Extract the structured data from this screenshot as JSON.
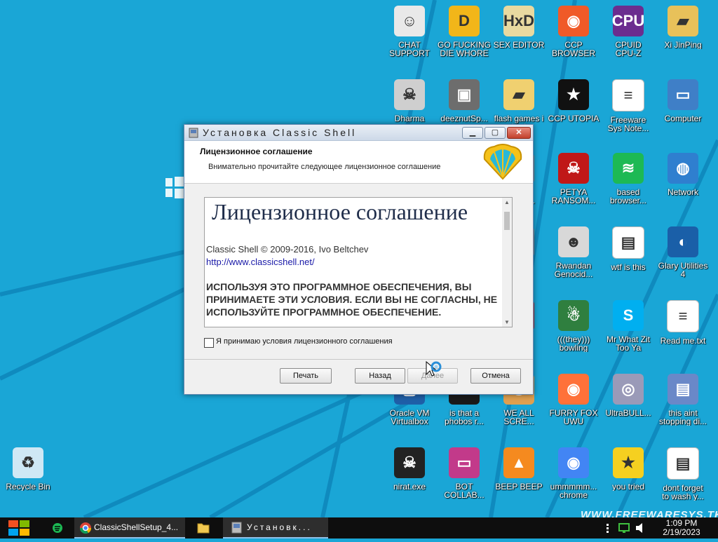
{
  "installer": {
    "title": "Установка Classic Shell",
    "min_label": "▁",
    "max_label": "▢",
    "close_label": "✕",
    "header_title": "Лицензионное соглашение",
    "header_subtitle": "Внимательно прочитайте следующее лицензионное соглашение",
    "license": {
      "heading": "Лицензионное соглашение",
      "copyright": "Classic Shell © 2009-2016, Ivo Beltchev",
      "link": "http://www.classicshell.net/",
      "notice": "ИСПОЛЬЗУЯ ЭТО ПРОГРАММНОЕ ОБЕСПЕЧЕНИЯ, ВЫ ПРИНИМАЕТЕ ЭТИ УСЛОВИЯ. ЕСЛИ ВЫ НЕ СОГЛАСНЫ, НЕ ИСПОЛЬЗУЙТЕ ПРОГРАММНОЕ ОБЕСПЕЧЕНИЕ."
    },
    "accept_label": "Я принимаю условия лицензионного соглашения",
    "accept_checked": false,
    "buttons": {
      "print": "Печать",
      "back": "Назад",
      "next": "Далее",
      "cancel": "Отмена"
    }
  },
  "desktop_icons": [
    {
      "label": "CHAT\nSUPPORT",
      "icon": "doctor-icon",
      "color": "#e9e9e9"
    },
    {
      "label": "GO FUCKING\nDIE WHORE",
      "icon": "die-icon",
      "color": "#f2b619"
    },
    {
      "label": "SEX EDITOR",
      "icon": "hxd-icon",
      "color": "#e8d9a0"
    },
    {
      "label": "CCP\nBROWSER",
      "icon": "browser-icon",
      "color": "#f05a28"
    },
    {
      "label": "CPUID\nCPU-Z",
      "icon": "cpuz-icon",
      "color": "#6b2d8f"
    },
    {
      "label": "Xi JinPing",
      "icon": "folder-user-icon",
      "color": "#e8c15a"
    },
    {
      "label": "Dharma",
      "icon": "skull-icon",
      "color": "#cfcfcf"
    },
    {
      "label": "deeznutSp...",
      "icon": "windows-stack-icon",
      "color": "#6d6d6d"
    },
    {
      "label": "flash games i\nhad",
      "icon": "folder-icon",
      "color": "#f0d070"
    },
    {
      "label": "CCP UTOPIA",
      "icon": "ccp-icon",
      "color": "#111111"
    },
    {
      "label": "Freeware\nSys Note...",
      "icon": "document-icon",
      "color": "#ffffff"
    },
    {
      "label": "Computer",
      "icon": "computer-icon",
      "color": "#3f7fc7"
    },
    {
      "label": "...NG\nNSOM...",
      "icon": "partial-icon",
      "color": "#888888"
    },
    {
      "label": "PETYA\nRANSOM...",
      "icon": "skull-red-icon",
      "color": "#c01818"
    },
    {
      "label": "based\nbrowser...",
      "icon": "spotify-icon",
      "color": "#1db954"
    },
    {
      "label": "Network",
      "icon": "network-icon",
      "color": "#2f7fcf"
    },
    {
      "label": "...Y...",
      "icon": "partial-icon",
      "color": "#888888"
    },
    {
      "label": "Rwandan\nGenocid...",
      "icon": "meme-icon",
      "color": "#d8d8d8"
    },
    {
      "label": "wtf is this",
      "icon": "window-file-icon",
      "color": "#ffffff"
    },
    {
      "label": "Glary Utilities\n4",
      "icon": "glary-icon",
      "color": "#1a5fa8"
    },
    {
      "label": "...de",
      "icon": "partial-icon",
      "color": "#c23030"
    },
    {
      "label": "(((they)))\nbowling",
      "icon": "elf-icon",
      "color": "#2f7f3f"
    },
    {
      "label": "Mr What Zit\nToo Ya",
      "icon": "skype-icon",
      "color": "#00aff0"
    },
    {
      "label": "Read me.txt",
      "icon": "text-file-icon",
      "color": "#ffffff"
    },
    {
      "label": "Oracle VM\nVirtualbox",
      "icon": "virtualbox-icon",
      "color": "#1f5fa8"
    },
    {
      "label": "is that a\nphobos r...",
      "icon": "frog-icon",
      "color": "#1a1a1a"
    },
    {
      "label": "WE ALL\nSCRE...",
      "icon": "scream-icon",
      "color": "#e0a050"
    },
    {
      "label": "FURRY FOX\nUWU",
      "icon": "firefox-icon",
      "color": "#ff7139"
    },
    {
      "label": "UltraBULL...",
      "icon": "disc-icon",
      "color": "#9a9ab8"
    },
    {
      "label": "this aint\nstopping di...",
      "icon": "installer-icon",
      "color": "#6a88c8"
    },
    {
      "label": "Recycle Bin",
      "icon": "recycle-bin-icon",
      "color": "#cfe8f5"
    },
    {
      "label": "nirat.exe",
      "icon": "skull-white-icon",
      "color": "#222222"
    },
    {
      "label": "BOT\nCOLLAB...",
      "icon": "monitor-pink-icon",
      "color": "#c23a8a"
    },
    {
      "label": "BEEP BEEP",
      "icon": "vlc-icon",
      "color": "#f58a1f"
    },
    {
      "label": "ummmmm...\nchrome",
      "icon": "chrome-icon",
      "color": "#4285f4"
    },
    {
      "label": "you tried",
      "icon": "star-icon",
      "color": "#f5d020"
    },
    {
      "label": "dont forget\nto wash y...",
      "icon": "window-file-icon",
      "color": "#ffffff"
    }
  ],
  "taskbar": {
    "chrome_task": "ClassicShellSetup_4...",
    "installer_task": "Установк...",
    "time": "1:09 PM",
    "date": "2/19/2023"
  },
  "watermark": "WWW.FREEWARESYS.TK"
}
